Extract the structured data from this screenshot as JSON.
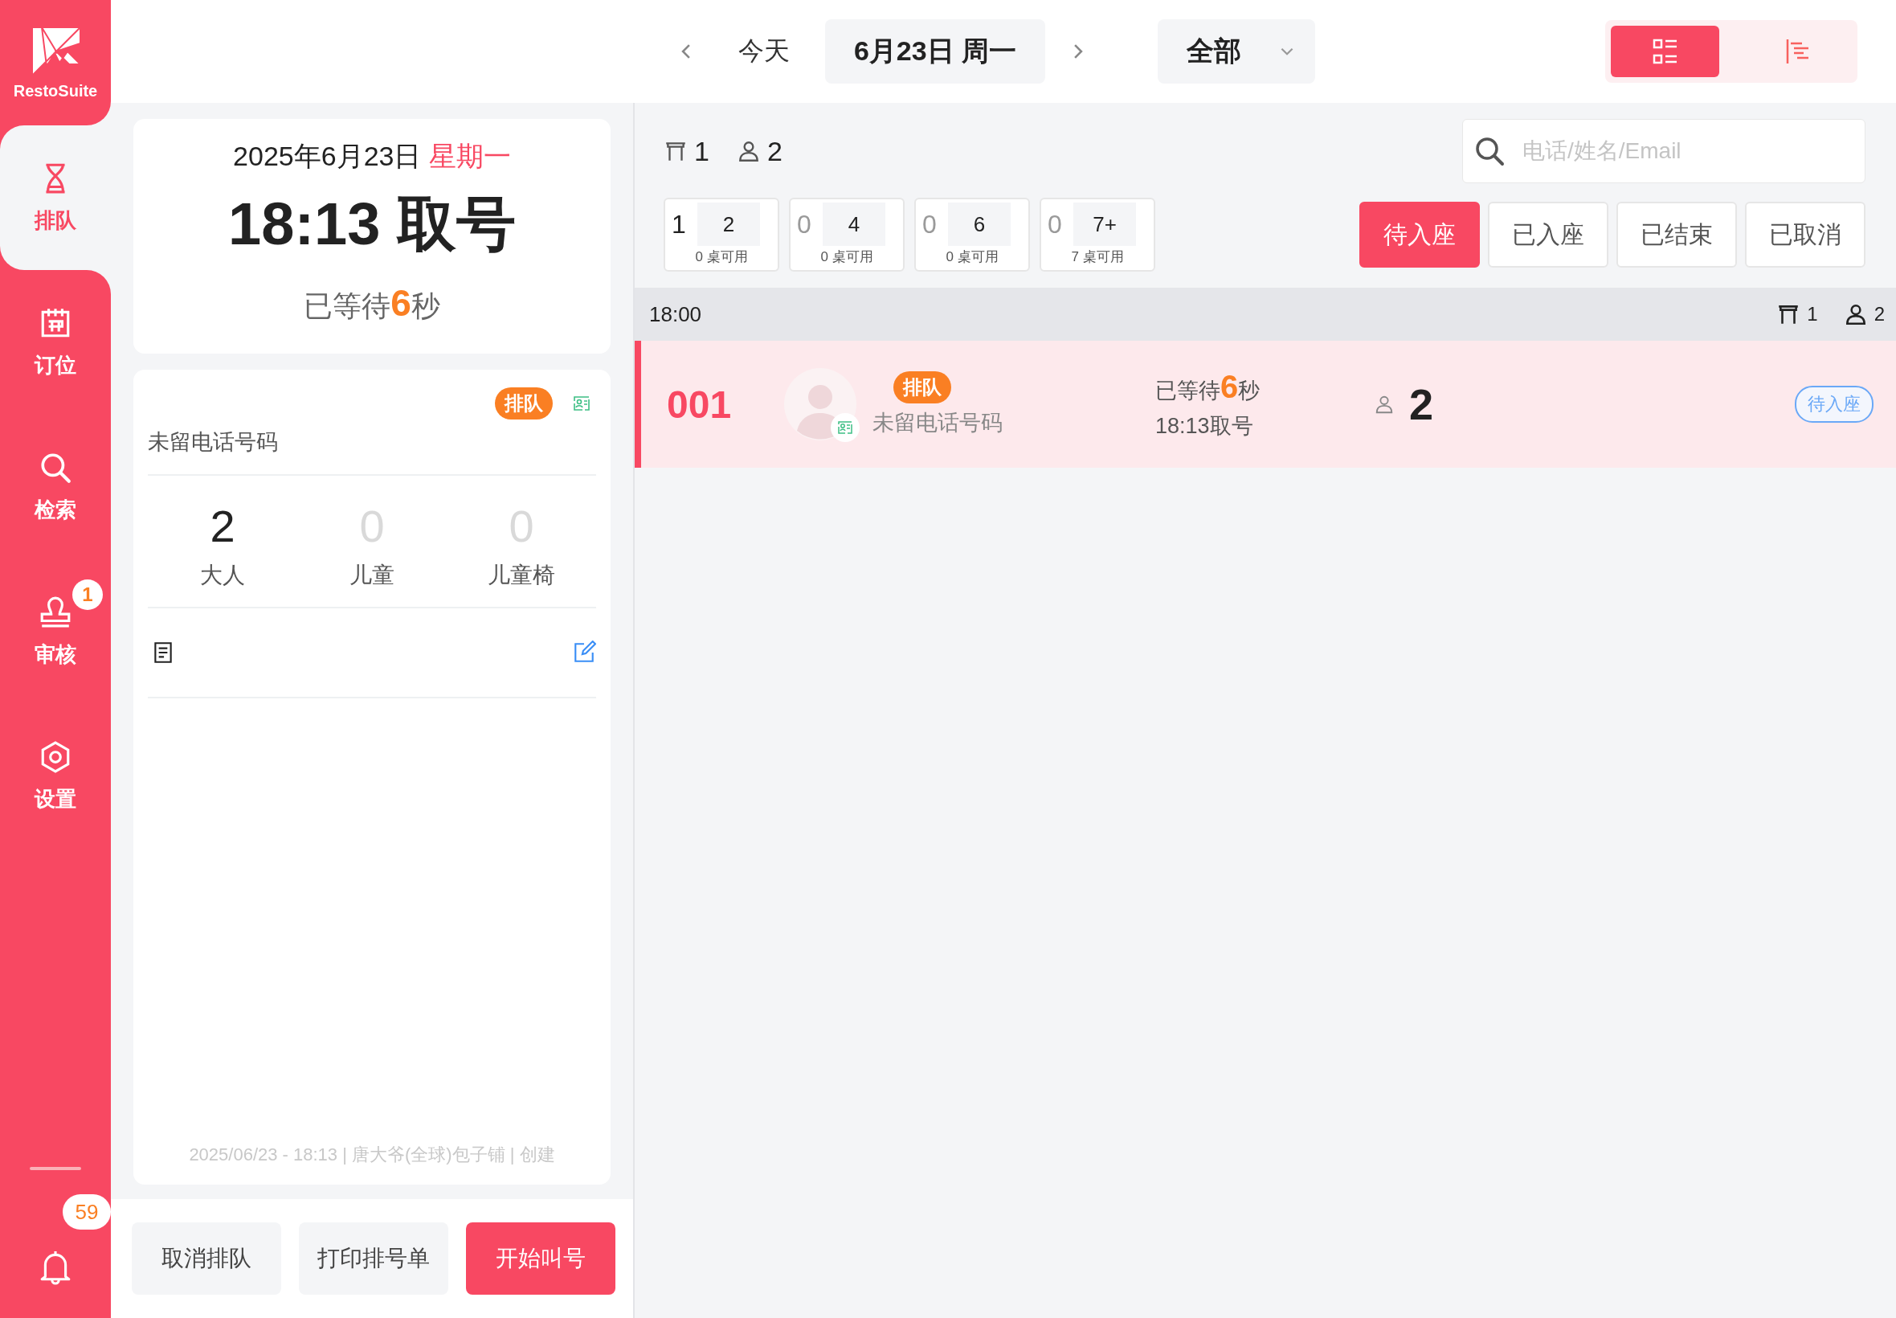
{
  "sidebar": {
    "logo_text": "RestoSuite",
    "items": [
      {
        "label": "排队",
        "selected": true
      },
      {
        "label": "订位",
        "selected": false
      },
      {
        "label": "检索",
        "selected": false
      },
      {
        "label": "审核",
        "selected": false,
        "badge": "1"
      },
      {
        "label": "设置",
        "selected": false
      }
    ],
    "notification_badge": "59"
  },
  "header": {
    "today": "今天",
    "date": "6月23日 周一",
    "filter": "全部",
    "view_toggle": [
      {
        "selected": true
      },
      {
        "selected": false
      }
    ]
  },
  "ticket": {
    "date": "2025年6月23日",
    "weekday": "星期一",
    "title": "18:13 取号",
    "wait_prefix": "已等待",
    "wait_value": "6",
    "wait_suffix": "秒"
  },
  "detail": {
    "tag": "排队",
    "phone": "未留电话号码",
    "counts": [
      {
        "value": "2",
        "label": "大人",
        "muted": false
      },
      {
        "value": "0",
        "label": "儿童",
        "muted": true
      },
      {
        "value": "0",
        "label": "儿童椅",
        "muted": true
      }
    ],
    "footer": "2025/06/23 - 18:13 | 唐大爷(全球)包子铺 | 创建"
  },
  "actions": [
    {
      "label": "取消排队",
      "kind": "secondary"
    },
    {
      "label": "打印排号单",
      "kind": "secondary"
    },
    {
      "label": "开始叫号",
      "kind": "primary"
    }
  ],
  "summary": {
    "tables": "1",
    "guests": "2"
  },
  "search": {
    "placeholder": "电话/姓名/Email"
  },
  "table_sizes": [
    {
      "count": "1",
      "size": "2",
      "available": "0 桌可用",
      "muted": false
    },
    {
      "count": "0",
      "size": "4",
      "available": "0 桌可用",
      "muted": true
    },
    {
      "count": "0",
      "size": "6",
      "available": "0 桌可用",
      "muted": true
    },
    {
      "count": "0",
      "size": "7+",
      "available": "7 桌可用",
      "muted": true
    }
  ],
  "status_tabs": [
    {
      "label": "待入座",
      "selected": true
    },
    {
      "label": "已入座",
      "selected": false
    },
    {
      "label": "已结束",
      "selected": false
    },
    {
      "label": "已取消",
      "selected": false
    }
  ],
  "groups": [
    {
      "time": "18:00",
      "tables": "1",
      "guests": "2",
      "rows": [
        {
          "number": "001",
          "tag": "排队",
          "phone": "未留电话号码",
          "wait_prefix": "已等待",
          "wait_value": "6",
          "wait_suffix": "秒",
          "taken": "18:13取号",
          "party": "2",
          "status": "待入座",
          "selected": true
        }
      ]
    }
  ]
}
